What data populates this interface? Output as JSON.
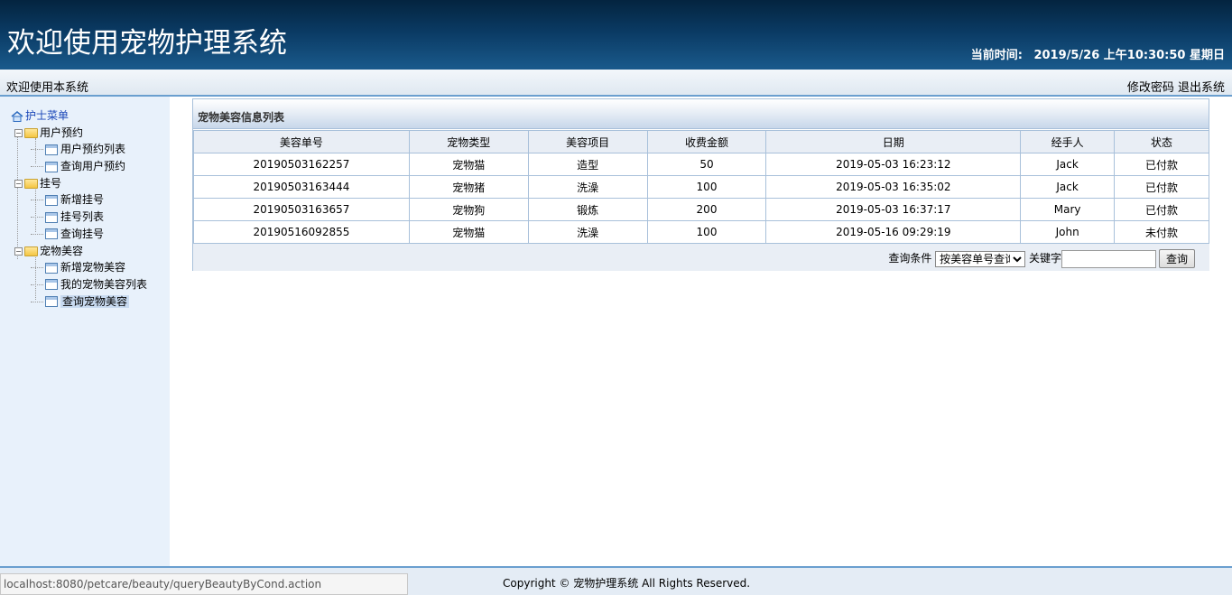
{
  "header": {
    "title": "欢迎使用宠物护理系统",
    "clock_label": "当前时间:",
    "clock_value": "2019/5/26 上午10:30:50 星期日"
  },
  "subbar": {
    "welcome": "欢迎使用本系统",
    "change_password": "修改密码",
    "logout": "退出系统"
  },
  "sidebar": {
    "root": "护士菜单",
    "groups": [
      {
        "label": "用户预约",
        "items": [
          "用户预约列表",
          "查询用户预约"
        ]
      },
      {
        "label": "挂号",
        "items": [
          "新增挂号",
          "挂号列表",
          "查询挂号"
        ]
      },
      {
        "label": "宠物美容",
        "items": [
          "新增宠物美容",
          "我的宠物美容列表",
          "查询宠物美容"
        ]
      }
    ]
  },
  "panel": {
    "title": "宠物美容信息列表",
    "columns": [
      "美容单号",
      "宠物类型",
      "美容项目",
      "收费金额",
      "日期",
      "经手人",
      "状态"
    ],
    "rows": [
      [
        "20190503162257",
        "宠物猫",
        "造型",
        "50",
        "2019-05-03 16:23:12",
        "Jack",
        "已付款"
      ],
      [
        "20190503163444",
        "宠物猪",
        "洗澡",
        "100",
        "2019-05-03 16:35:02",
        "Jack",
        "已付款"
      ],
      [
        "20190503163657",
        "宠物狗",
        "锻炼",
        "200",
        "2019-05-03 16:37:17",
        "Mary",
        "已付款"
      ],
      [
        "20190516092855",
        "宠物猫",
        "洗澡",
        "100",
        "2019-05-16 09:29:19",
        "John",
        "未付款"
      ]
    ]
  },
  "search": {
    "condition_label": "查询条件",
    "condition_selected": "按美容单号查询",
    "keyword_label": "关键字",
    "keyword_value": "",
    "button": "查询"
  },
  "footer": {
    "copyright": "Copyright © 宠物护理系统 All Rights Reserved.",
    "status_url": "localhost:8080/petcare/beauty/queryBeautyByCond.action"
  }
}
